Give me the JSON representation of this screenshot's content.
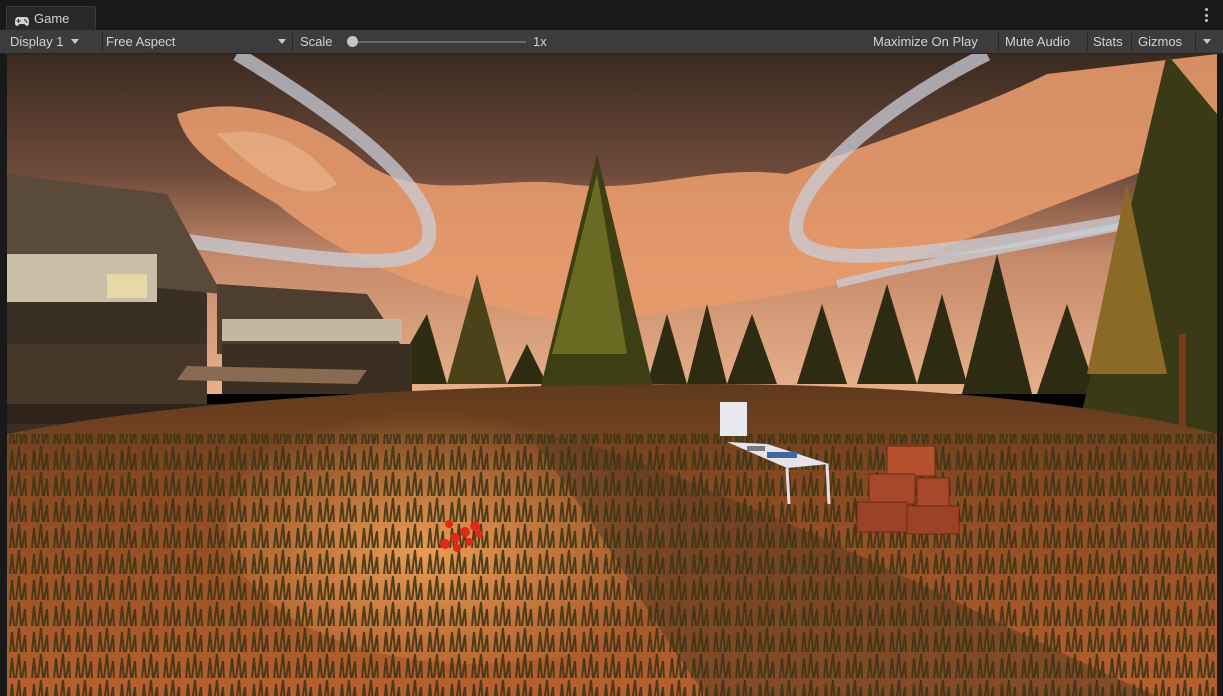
{
  "window": {
    "tab_title": "Game",
    "tab_icon": "gamepad-icon",
    "menu_icon": "kebab-menu-icon"
  },
  "toolbar": {
    "display_label": "Display 1",
    "aspect_label": "Free Aspect",
    "scale_label": "Scale",
    "scale_value": "1x",
    "scale_fraction": 0.0,
    "maximize_on_play": "Maximize On Play",
    "mute_audio": "Mute Audio",
    "stats": "Stats",
    "gizmos": "Gizmos"
  },
  "viewport": {
    "scene": "Sunset meadow with wooden village buildings, pine trees, a table with items, stacked crates and scattered red objects",
    "colors": {
      "sky_top": "#3a2a20",
      "sky_glow": "#d88a5a",
      "ground": "#a8552a",
      "trees": "#3b3a14"
    }
  }
}
